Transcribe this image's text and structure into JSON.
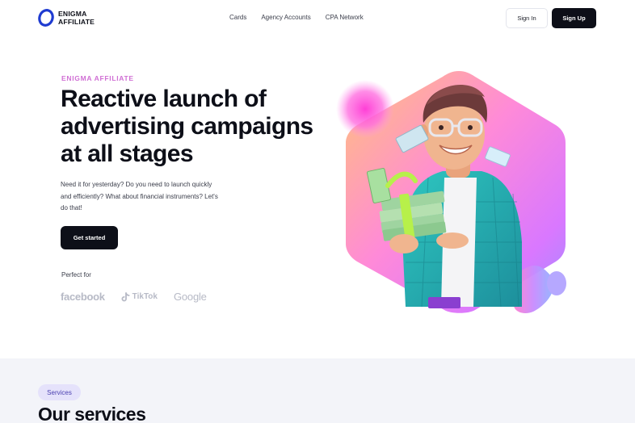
{
  "header": {
    "logo_line1": "ENIGMA",
    "logo_line2": "AFFILIATE",
    "nav": [
      "Cards",
      "Agency Accounts",
      "CPA Network"
    ],
    "signin_label": "Sign In",
    "signup_label": "Sign Up"
  },
  "hero": {
    "eyebrow": "ENIGMA AFFILIATE",
    "title": "Reactive launch of advertising campaigns at all stages",
    "description": "Need it for yesterday? Do you need to launch quickly and efficiently? What about financial instruments? Let's do that!",
    "cta_label": "Get started",
    "perfect_for": "Perfect for",
    "partners": [
      "facebook",
      "TikTok",
      "Google"
    ]
  },
  "services": {
    "pill": "Services",
    "title": "Our services"
  },
  "colors": {
    "dark": "#0d0f18",
    "eyebrow": "#d06fd4",
    "section_bg": "#f3f4f9",
    "pill_bg": "#e5e2fb"
  },
  "icons": {
    "logo": "enigma-logo-icon",
    "tiktok": "tiktok-icon"
  }
}
